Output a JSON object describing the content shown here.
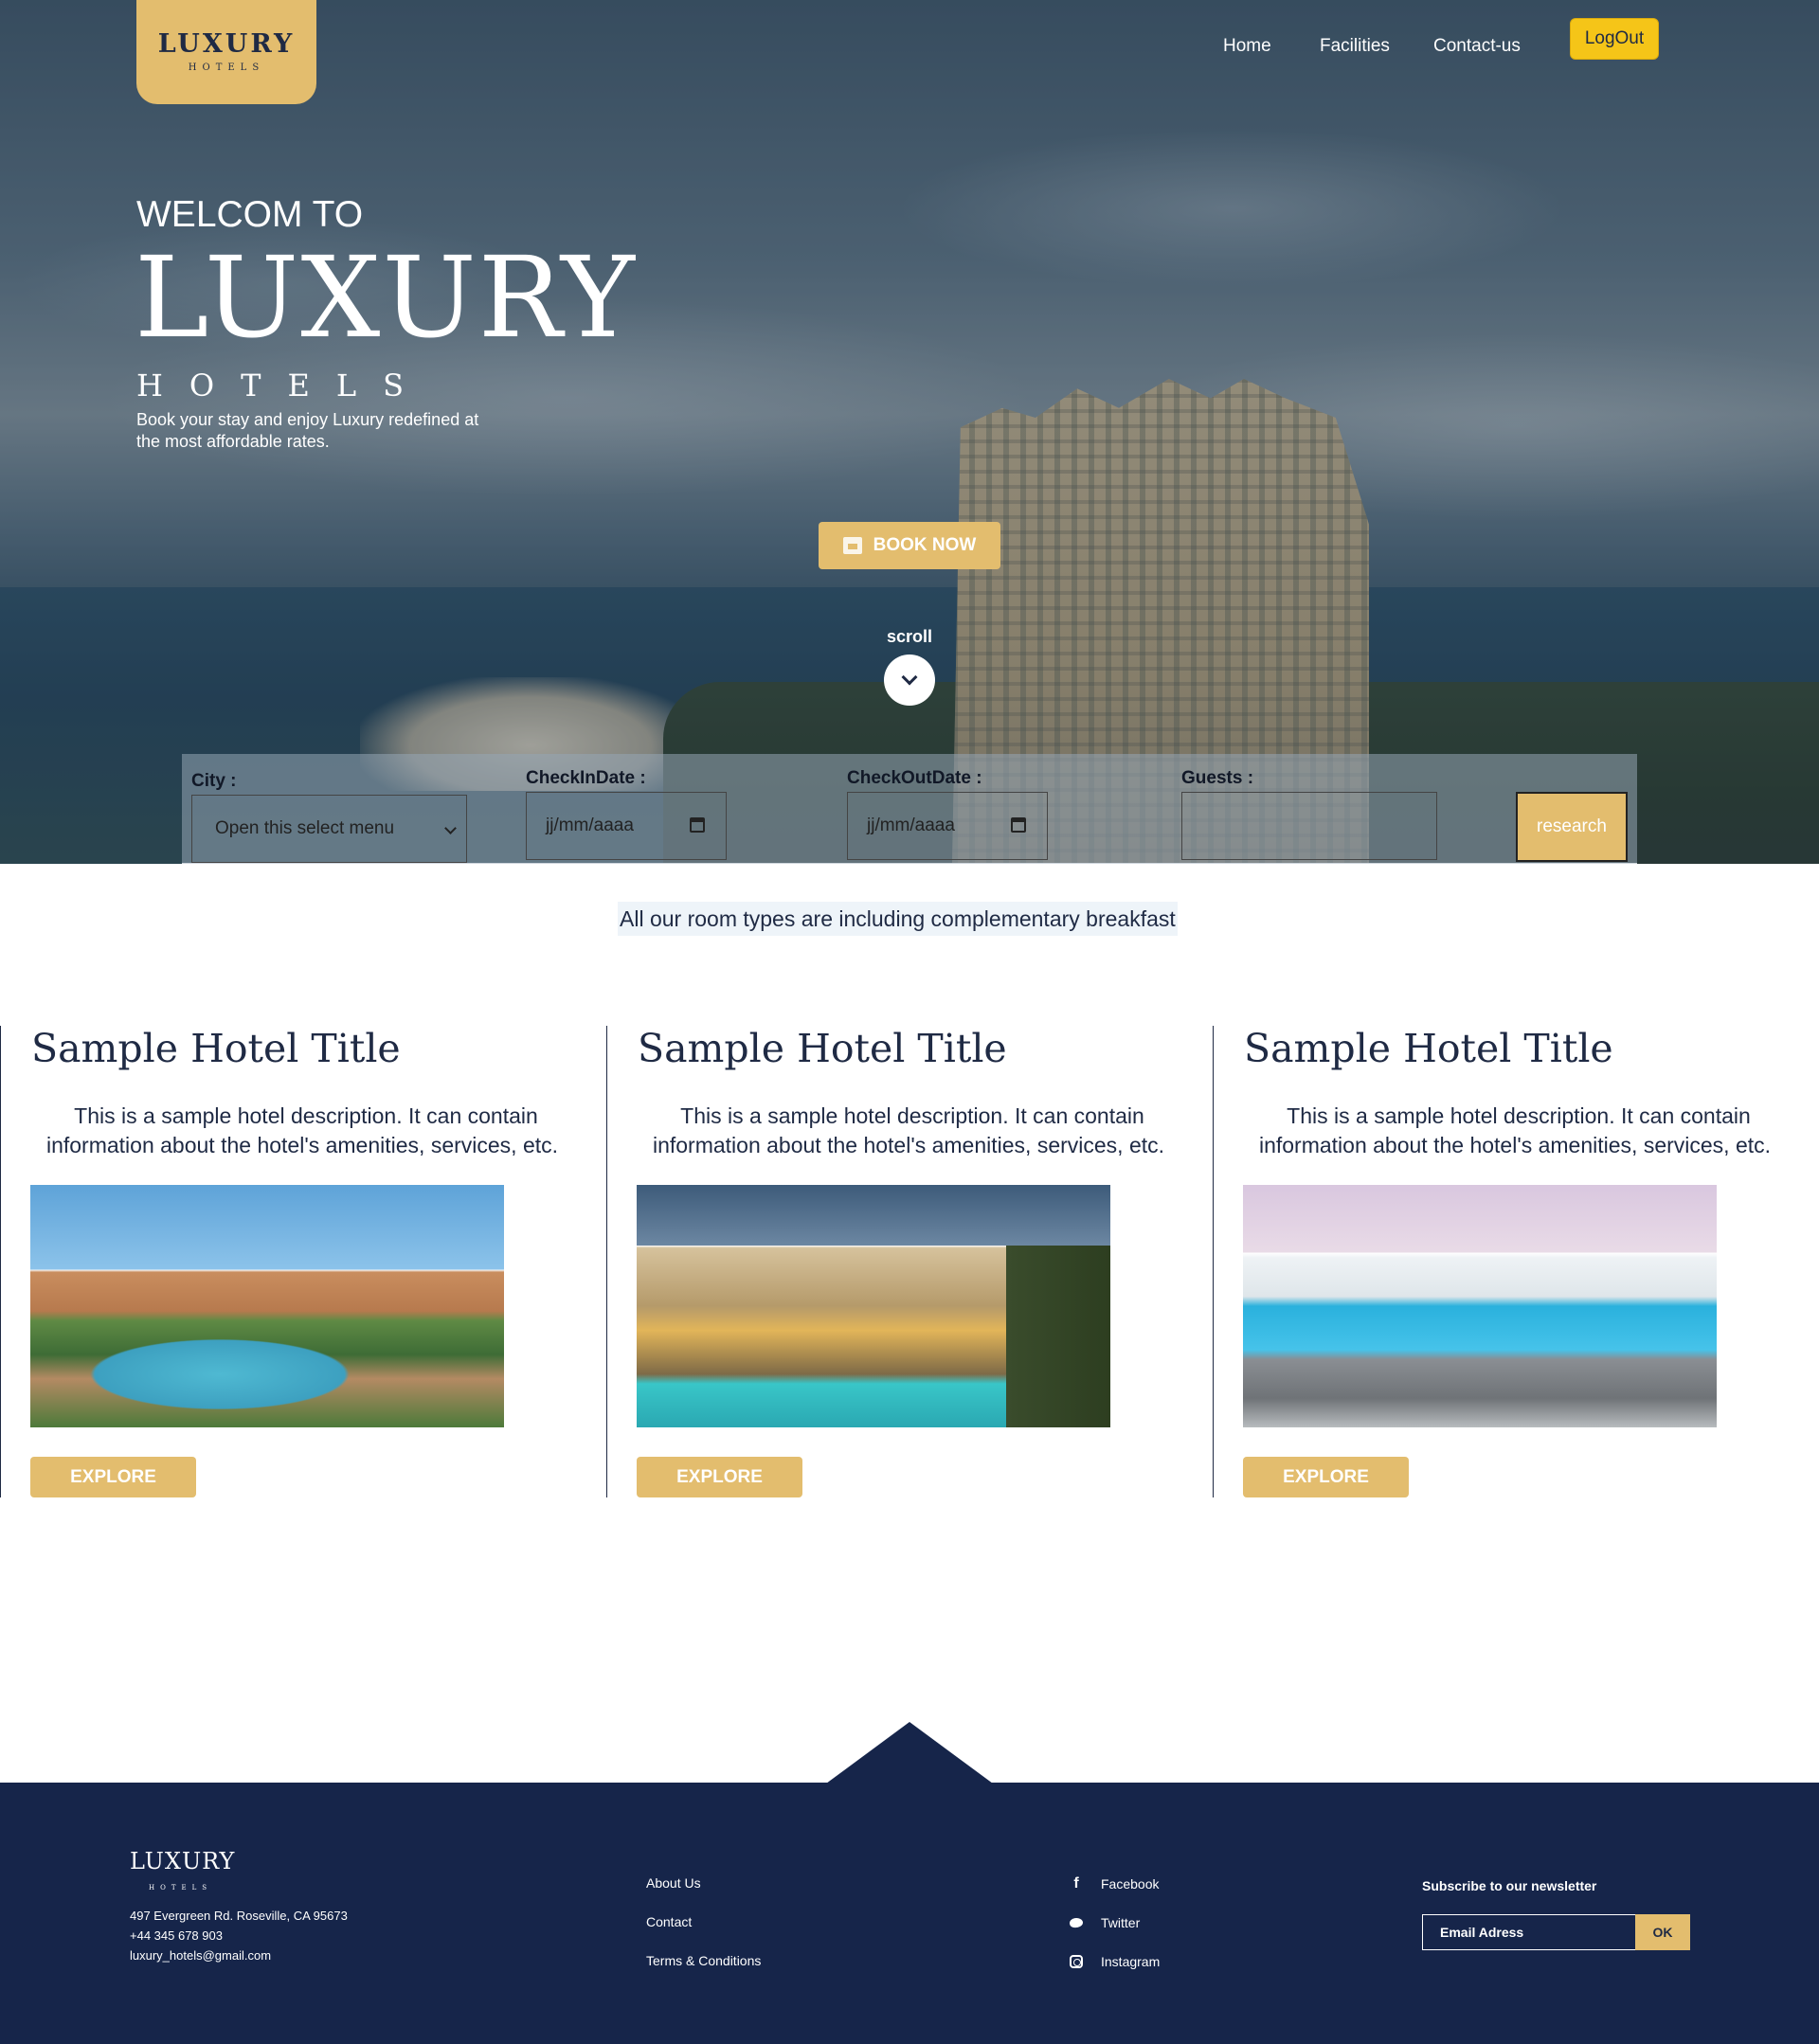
{
  "header": {
    "logo_main": "LUXURY",
    "logo_sub": "HOTELS",
    "nav": {
      "home": "Home",
      "facilities": "Facilities",
      "contact": "Contact-us"
    },
    "logout_label": "LogOut"
  },
  "hero": {
    "welcome": "WELCOM TO",
    "title": "LUXURY",
    "subtitle": "HOTELS",
    "tagline": "Book your stay and enjoy Luxury redefined at the most affordable rates.",
    "book_label": "BOOK NOW",
    "scroll_label": "scroll"
  },
  "search": {
    "city_label": "City :",
    "city_value": "Open this select menu",
    "checkin_label": "CheckInDate :",
    "checkin_placeholder": "jj/mm/aaaa",
    "checkout_label": "CheckOutDate :",
    "checkout_placeholder": "jj/mm/aaaa",
    "guests_label": "Guests :",
    "guests_value": "",
    "submit_label": "research"
  },
  "note": "All our room types are including complementary breakfast",
  "cards": [
    {
      "title": "Sample Hotel Title",
      "description": "This is a sample hotel description. It can contain information about the hotel's amenities, services, etc.",
      "button": "EXPLORE"
    },
    {
      "title": "Sample Hotel Title",
      "description": "This is a sample hotel description. It can contain information about the hotel's amenities, services, etc.",
      "button": "EXPLORE"
    },
    {
      "title": "Sample Hotel Title",
      "description": "This is a sample hotel description. It can contain information about the hotel's amenities, services, etc.",
      "button": "EXPLORE"
    }
  ],
  "footer": {
    "logo_main": "LUXURY",
    "logo_sub": "HOTELS",
    "address": "497 Evergreen Rd. Roseville, CA 95673",
    "phone": "+44 345 678 903",
    "email": "luxury_hotels@gmail.com",
    "links": {
      "about": "About Us",
      "contact": "Contact",
      "terms": "Terms & Conditions"
    },
    "social": {
      "facebook": "Facebook",
      "twitter": "Twitter",
      "instagram": "Instagram"
    },
    "newsletter_title": "Subscribe to our newsletter",
    "newsletter_placeholder": "Email Adress",
    "newsletter_button": "OK"
  },
  "colors": {
    "accent": "#e3bd6e",
    "navy": "#16254a",
    "logout": "#f5c518"
  }
}
